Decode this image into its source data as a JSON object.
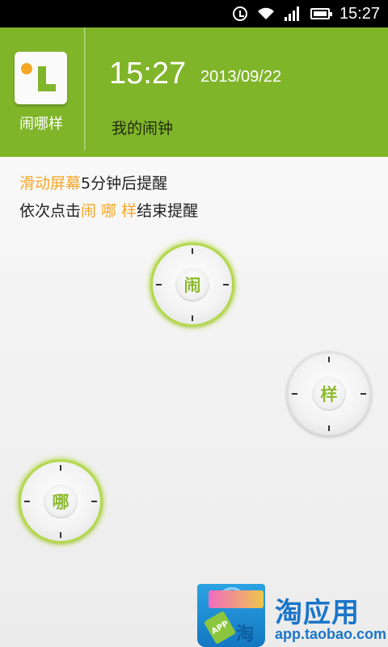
{
  "status_bar": {
    "time": "15:27",
    "icons": [
      "alarm-icon",
      "wifi-icon",
      "signal-icon",
      "battery-icon"
    ]
  },
  "header": {
    "app_name": "闹哪样",
    "time": "15:27",
    "date": "2013/09/22",
    "alarm_label": "我的闹钟",
    "bg_color": "#80b52a"
  },
  "instructions": {
    "line1_highlight": "滑动屏幕",
    "line1_rest": "5分钟后提醒",
    "line2_prefix": "依次点击",
    "line2_highlight": "闹 哪 样",
    "line2_suffix": "结束提醒",
    "highlight_color": "#f5a623"
  },
  "dials": {
    "nao": "闹",
    "yang": "样",
    "na": "哪"
  },
  "taobao_badge": {
    "title": "淘应用",
    "url": "app.taobao.com",
    "tag": "APP",
    "bag_char": "淘"
  }
}
